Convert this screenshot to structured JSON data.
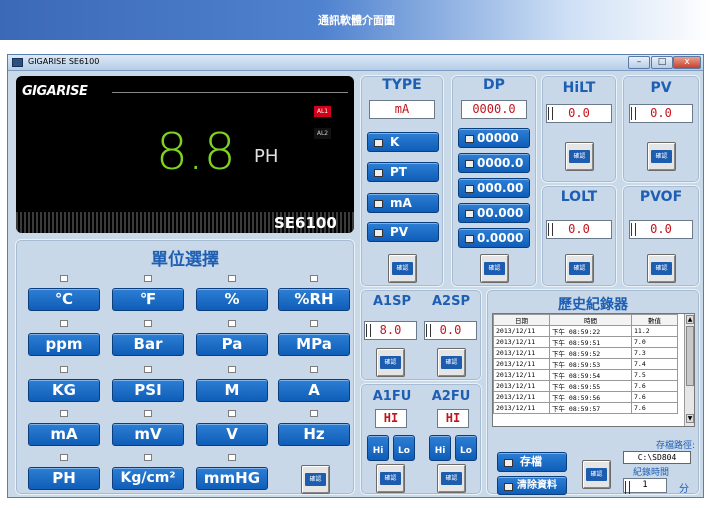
{
  "banner": {
    "title": "通訊軟體介面圖"
  },
  "window": {
    "title": "GIGARISE    SE6100",
    "minimize": "–",
    "maximize": "□",
    "close": "x"
  },
  "display": {
    "logo": "GIGARISE",
    "value": "8.8",
    "unit": "PH",
    "alarm1": "AL1",
    "alarm2": "AL2",
    "model": "SE6100"
  },
  "type_panel": {
    "title": "TYPE",
    "value": "mA",
    "options": [
      "K",
      "PT",
      "mA",
      "PV"
    ],
    "confirm": "確認"
  },
  "dp_panel": {
    "title": "DP",
    "value": "0000.0",
    "options": [
      "00000",
      "0000.0",
      "000.00",
      "00.000",
      "0.0000"
    ],
    "confirm": "確認"
  },
  "hilt": {
    "title": "HiLT",
    "value": "0.0",
    "confirm": "確認"
  },
  "pv": {
    "title": "PV",
    "value": "0.0",
    "confirm": "確認"
  },
  "lolt": {
    "title": "LOLT",
    "value": "0.0",
    "confirm": "確認"
  },
  "pvof": {
    "title": "PVOF",
    "value": "0.0",
    "confirm": "確認"
  },
  "units": {
    "title": "單位選擇",
    "rows": [
      [
        "℃",
        "℉",
        "%",
        "%RH"
      ],
      [
        "ppm",
        "Bar",
        "Pa",
        "MPa"
      ],
      [
        "KG",
        "PSI",
        "M",
        "A"
      ],
      [
        "mA",
        "mV",
        "V",
        "Hz"
      ],
      [
        "PH",
        "Kg/cm²",
        "mmHG"
      ]
    ],
    "confirm": "確認"
  },
  "a_sp": {
    "title1": "A1SP",
    "title2": "A2SP",
    "value1": "8.0",
    "value2": "0.0",
    "confirm": "確認"
  },
  "a_fu": {
    "title1": "A1FU",
    "title2": "A2FU",
    "value1": "HI",
    "value2": "HI",
    "hi": "Hi",
    "lo": "Lo",
    "confirm": "確認"
  },
  "history": {
    "title": "歷史紀錄器",
    "headers": [
      "日期",
      "時間",
      "數值"
    ],
    "rows": [
      [
        "2013/12/11",
        "下午 08:59:22",
        "11.2"
      ],
      [
        "2013/12/11",
        "下午 08:59:51",
        "7.0"
      ],
      [
        "2013/12/11",
        "下午 08:59:52",
        "7.3"
      ],
      [
        "2013/12/11",
        "下午 08:59:53",
        "7.4"
      ],
      [
        "2013/12/11",
        "下午 08:59:54",
        "7.5"
      ],
      [
        "2013/12/11",
        "下午 08:59:55",
        "7.6"
      ],
      [
        "2013/12/11",
        "下午 08:59:56",
        "7.6"
      ],
      [
        "2013/12/11",
        "下午 08:59:57",
        "7.6"
      ]
    ],
    "save": "存檔",
    "clear": "清除資料",
    "confirm": "確認",
    "path_label": "存檔路徑:",
    "path_value": "C:\\SD804",
    "interval_label": "紀錄時間",
    "interval_value": "1",
    "interval_unit": "分"
  },
  "colors": {
    "accent": "#1e5fb3",
    "value_red": "#c0161f",
    "lcd_green": "#7ed321",
    "button_blue": "#1565c0"
  }
}
